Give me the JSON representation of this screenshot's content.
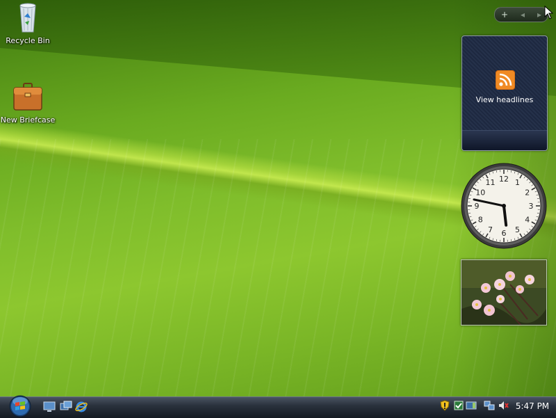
{
  "desktop": {
    "icons": [
      {
        "label": "Recycle Bin",
        "icon": "recycle-bin-icon"
      },
      {
        "label": "New Briefcase",
        "icon": "briefcase-icon"
      }
    ]
  },
  "sidebar": {
    "toolbar": {
      "add_label": "+",
      "prev_label": "◂",
      "next_label": "▸"
    },
    "feed_gadget": {
      "label": "View headlines",
      "icon": "rss-feed-icon",
      "accent": "#f08a24"
    },
    "clock_gadget": {
      "numbers": [
        "12",
        "1",
        "2",
        "3",
        "4",
        "5",
        "6",
        "7",
        "8",
        "9",
        "10",
        "11"
      ],
      "time": "5:47"
    },
    "slideshow_gadget": {
      "subject": "pink-flowers-photo"
    }
  },
  "taskbar": {
    "start_icon": "windows-start-orb-icon",
    "quick_launch": [
      {
        "icon": "show-desktop-icon"
      },
      {
        "icon": "switch-windows-icon"
      },
      {
        "icon": "internet-explorer-icon"
      }
    ],
    "tray": [
      {
        "icon": "security-shield-icon"
      },
      {
        "icon": "windows-defender-icon"
      },
      {
        "icon": "sidebar-icon"
      },
      {
        "icon": "network-icon"
      },
      {
        "icon": "volume-muted-icon"
      }
    ],
    "clock": "5:47 PM"
  },
  "colors": {
    "wallpaper": "#7fbd2b",
    "taskbar": "#1f2630",
    "feed_gadget_bg": "#222d45"
  }
}
